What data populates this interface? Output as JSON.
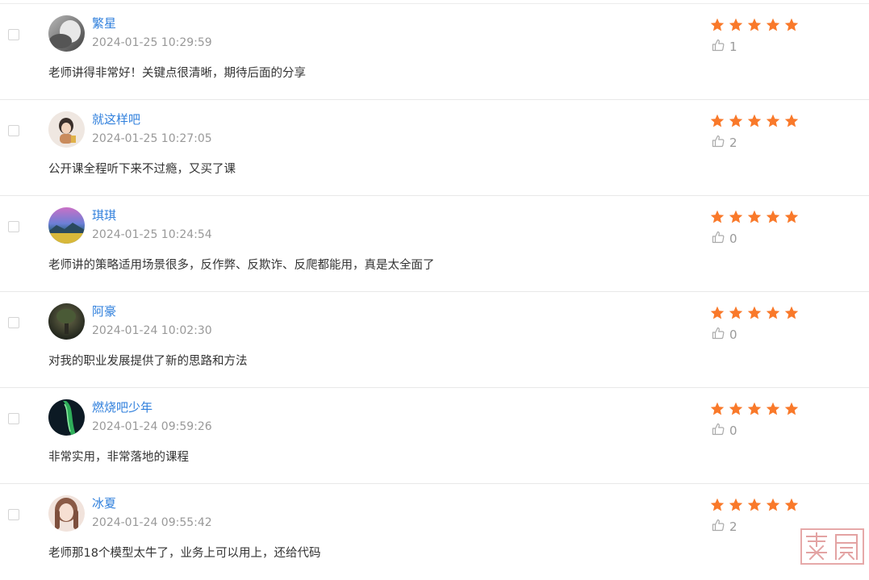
{
  "colors": {
    "username": "#2f7fdc",
    "star": "#f9792a",
    "timestamp": "#999999",
    "text": "#333333"
  },
  "icons": {
    "star": "star-icon",
    "like": "thumbs-up-icon"
  },
  "comments": [
    {
      "username": "繁星",
      "time": "2024-01-25 10:29:59",
      "content": "老师讲得非常好！关键点很清晰，期待后面的分享",
      "rating": 5,
      "likes": "1"
    },
    {
      "username": "就这样吧",
      "time": "2024-01-25 10:27:05",
      "content": "公开课全程听下来不过瘾，又买了课",
      "rating": 5,
      "likes": "2"
    },
    {
      "username": "琪琪",
      "time": "2024-01-25 10:24:54",
      "content": "老师讲的策略适用场景很多，反作弊、反欺诈、反爬都能用，真是太全面了",
      "rating": 5,
      "likes": "0"
    },
    {
      "username": "阿豪",
      "time": "2024-01-24 10:02:30",
      "content": "对我的职业发展提供了新的思路和方法",
      "rating": 5,
      "likes": "0"
    },
    {
      "username": "燃烧吧少年",
      "time": "2024-01-24 09:59:26",
      "content": "非常实用，非常落地的课程",
      "rating": 5,
      "likes": "0"
    },
    {
      "username": "冰夏",
      "time": "2024-01-24 09:55:42",
      "content": "老师那18个模型太牛了，业务上可以用上，还给代码",
      "rating": 5,
      "likes": "2"
    }
  ],
  "watermark": {
    "text": "栈鼎"
  }
}
